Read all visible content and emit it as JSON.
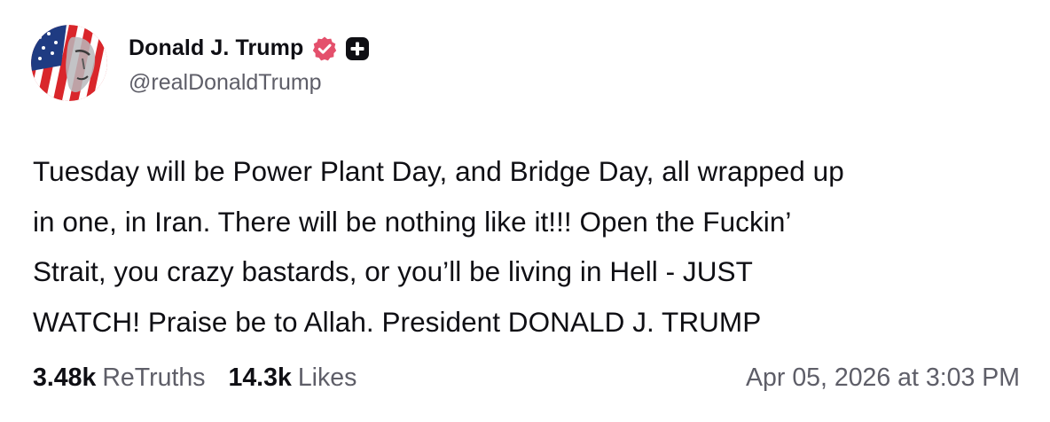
{
  "author": {
    "display_name": "Donald J. Trump",
    "handle": "@realDonaldTrump",
    "verified_icon": "verified-badge-icon",
    "plus_icon": "plus-square-icon"
  },
  "post": {
    "lines": [
      "Tuesday will be Power Plant Day, and Bridge Day, all wrapped up",
      "in one, in Iran. There will be nothing like it!!! Open the Fuckin’",
      "Strait, you crazy bastards, or you’ll be living in Hell - JUST",
      "WATCH! Praise be to Allah. President DONALD J. TRUMP"
    ]
  },
  "stats": {
    "retruths_count": "3.48k",
    "retruths_label": "ReTruths",
    "likes_count": "14.3k",
    "likes_label": "Likes"
  },
  "timestamp": "Apr 05, 2026 at 3:03 PM",
  "colors": {
    "text": "#0f0f14",
    "muted": "#5e5e68",
    "verified": "#e4506c"
  }
}
